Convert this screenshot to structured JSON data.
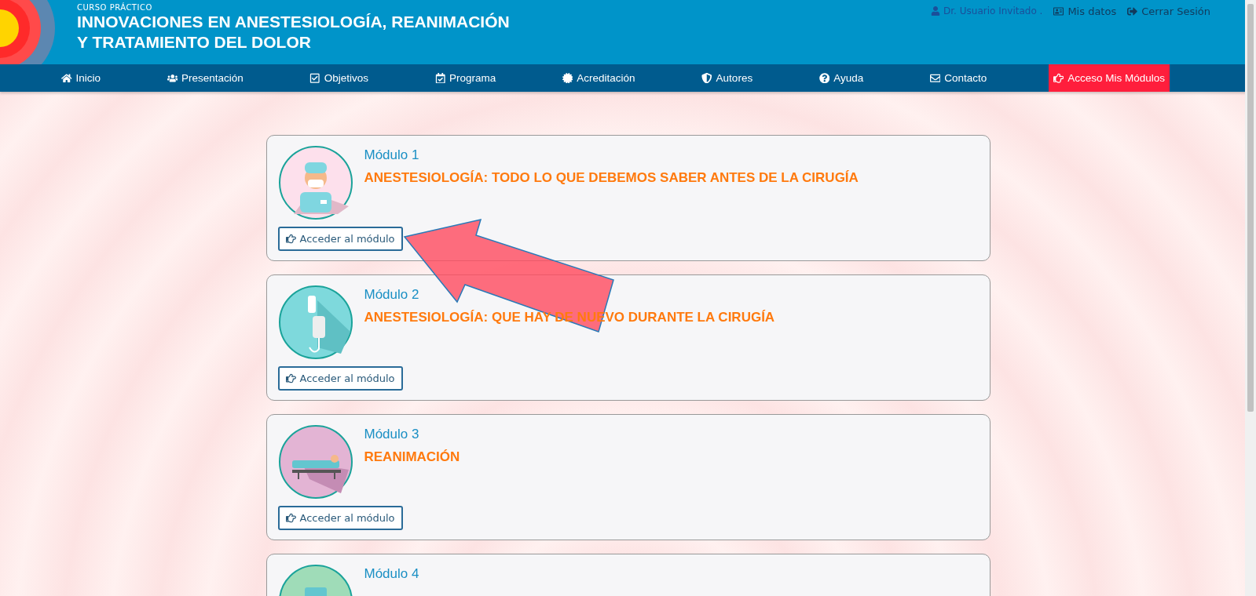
{
  "header": {
    "kicker": "CURSO PRÁCTICO",
    "title_lines": [
      "INNOVACIONES EN ANESTESIOLOGÍA, REANIMACIÓN",
      "Y TRATAMIENTO DEL DOLOR"
    ],
    "user": "Dr. Usuario Invitado .",
    "links": [
      "Mis datos",
      "Cerrar Sesión"
    ]
  },
  "nav": [
    {
      "label": "Inicio",
      "selected": false
    },
    {
      "label": "Presentación",
      "selected": false
    },
    {
      "label": "Objetivos",
      "selected": false
    },
    {
      "label": "Programa",
      "selected": false
    },
    {
      "label": "Acreditación",
      "selected": false
    },
    {
      "label": "Autores",
      "selected": false
    },
    {
      "label": "Ayuda",
      "selected": false
    },
    {
      "label": "Contacto",
      "selected": false
    },
    {
      "label": "Acceso Mis Módulos",
      "selected": true
    }
  ],
  "modules": [
    {
      "number": "Módulo 1",
      "title": "ANESTESIOLOGÍA: TODO LO QUE DEBEMOS SABER ANTES DE LA CIRUGÍA",
      "button": "Acceder al módulo"
    },
    {
      "number": "Módulo 2",
      "title": "ANESTESIOLOGÍA: QUE HAY DE NUEVO DURANTE LA CIRUGÍA",
      "button": "Acceder al módulo"
    },
    {
      "number": "Módulo 3",
      "title": "REANIMACIÓN",
      "button": "Acceder al módulo"
    },
    {
      "number": "Módulo 4"
    }
  ]
}
